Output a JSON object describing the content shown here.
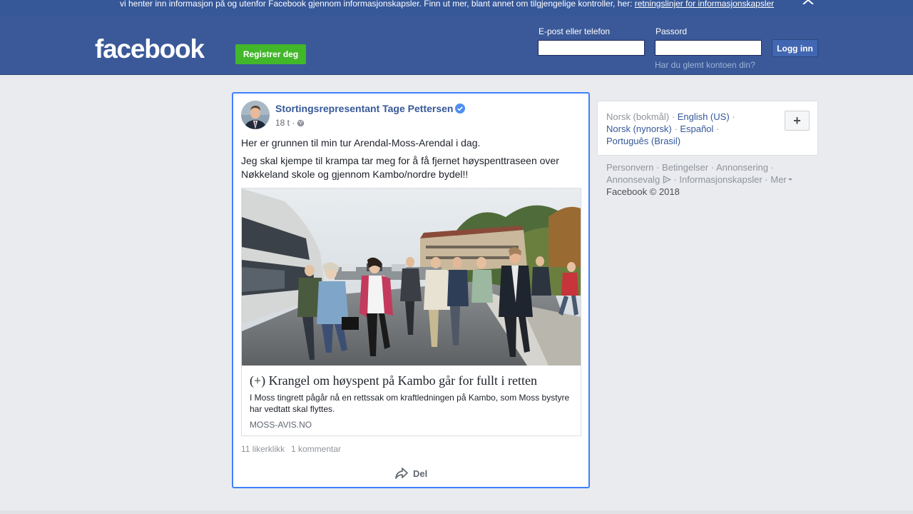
{
  "cookie_banner": {
    "text": "vi henter inn informasjon på og utenfor Facebook gjennom informasjonskapsler. Finn ut mer, blant annet om tilgjengelige kontroller, her: ",
    "link": "retningslinjer for informasjonskapsler",
    "close_icon": "close-icon"
  },
  "header": {
    "logo": "facebook",
    "register_label": "Registrer deg",
    "email_label": "E-post eller telefon",
    "email_value": "",
    "password_label": "Passord",
    "password_value": "",
    "login_label": "Logg inn",
    "forgot_label": "Har du glemt kontoen din?",
    "colors": {
      "bar": "#3b5998",
      "register": "#42b72a",
      "login": "#4267b2"
    }
  },
  "post": {
    "author": "Stortingsrepresentant Tage Pettersen",
    "verified_icon": "verified-badge-icon",
    "time": "18 t ·",
    "audience_icon": "globe-icon",
    "text_1": "Her er grunnen til min tur Arendal-Moss-Arendal i dag.",
    "text_2": "Jeg skal kjempe til krampa tar meg for å få fjernet høyspenttraseen over Nøkkeland skole og gjennom Kambo/nordre bydel!!",
    "link": {
      "title": "(+) Krangel om høyspent på Kambo går for fullt i retten",
      "description": "I Moss tingrett pågår nå en rettssak om kraftledningen på Kambo, som Moss bystyre har vedtatt skal flyttes.",
      "domain": "MOSS-AVIS.NO"
    },
    "likes": "11 likerklikk",
    "comments": "1 kommentar",
    "share_label": "Del",
    "share_icon": "share-arrow-icon"
  },
  "sidebar": {
    "languages": {
      "current": "Norsk (bokmål)",
      "options": [
        "English (US)",
        "Norsk (nynorsk)",
        "Español",
        "Português (Brasil)"
      ],
      "add_label": "+"
    },
    "footer_links": [
      "Personvern",
      "Betingelser",
      "Annonsering",
      "Annonsevalg",
      "Informasjonskapsler",
      "Mer"
    ],
    "copyright": "Facebook © 2018"
  }
}
